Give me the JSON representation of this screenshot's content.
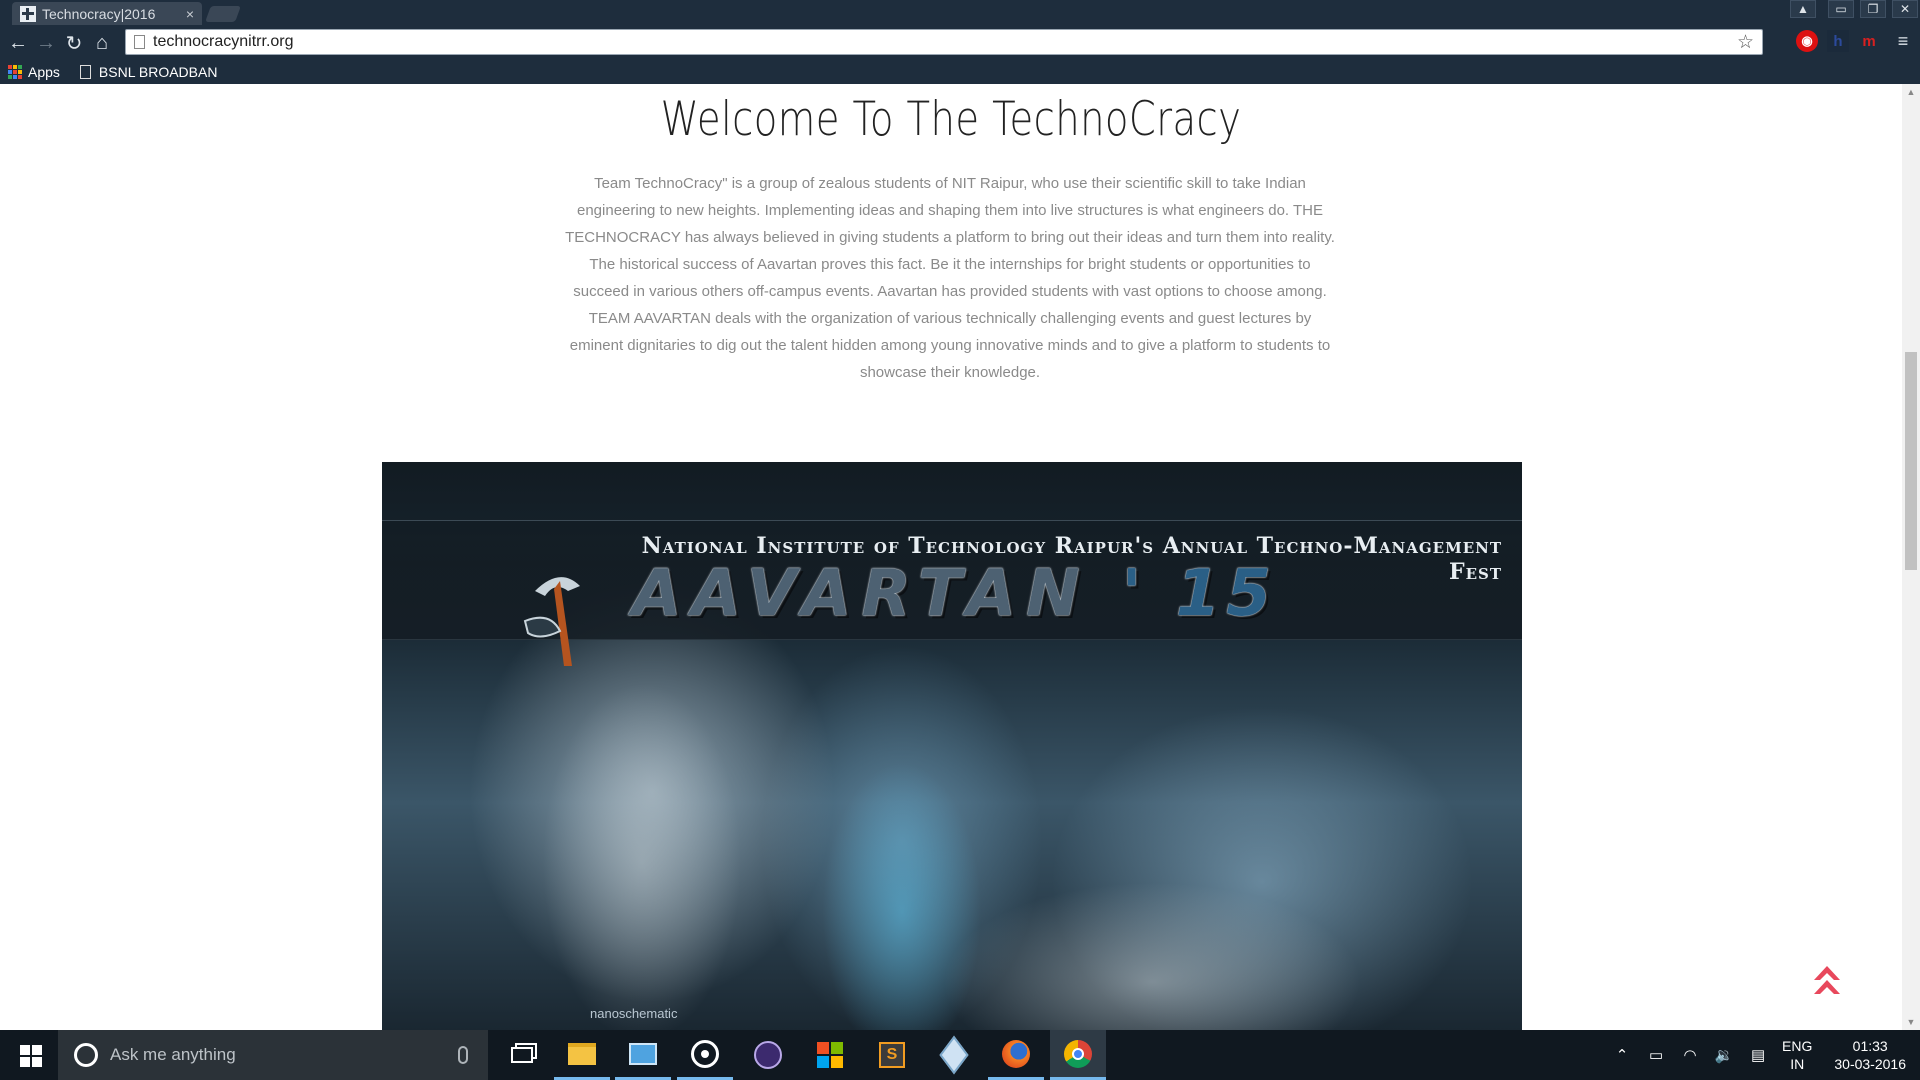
{
  "browser": {
    "tab_title": "Technocracy|2016",
    "tab_close": "×",
    "url": "technocracynitrr.org",
    "bookmarks": {
      "apps_label": "Apps",
      "item_1": "BSNL BROADBAN"
    }
  },
  "page": {
    "heading": "Welcome To The TechnoCracy",
    "intro": "Team TechnoCracy\" is a group of zealous students of NIT Raipur, who use their scientific skill to take Indian engineering to new heights. Implementing ideas and shaping them into live structures is what engineers do. THE TECHNOCRACY has always believed in giving students a platform to bring out their ideas and turn them into reality. The historical success of Aavartan proves this fact. Be it the internships for bright students or opportunities to succeed in various others off-campus events. Aavartan has provided students with vast options to choose among. TEAM AAVARTAN deals with the organization of various technically challenging events and guest lectures by eminent dignitaries to dig out the talent hidden among young innovative minds and to give a platform to students to showcase their knowledge.",
    "hero": {
      "subtitle": "National Institute of Technology Raipur's Annual Techno-Management Fest",
      "title": "AAVARTAN",
      "year": "' 15",
      "caption": "nanoschematic"
    }
  },
  "taskbar": {
    "search_placeholder": "Ask me anything",
    "lang_1": "ENG",
    "lang_2": "IN",
    "time": "01:33",
    "date": "30-03-2016"
  },
  "colors": {
    "chrome": "#1e2d3d",
    "totop": "#e8485c",
    "taskbar": "#101820"
  }
}
